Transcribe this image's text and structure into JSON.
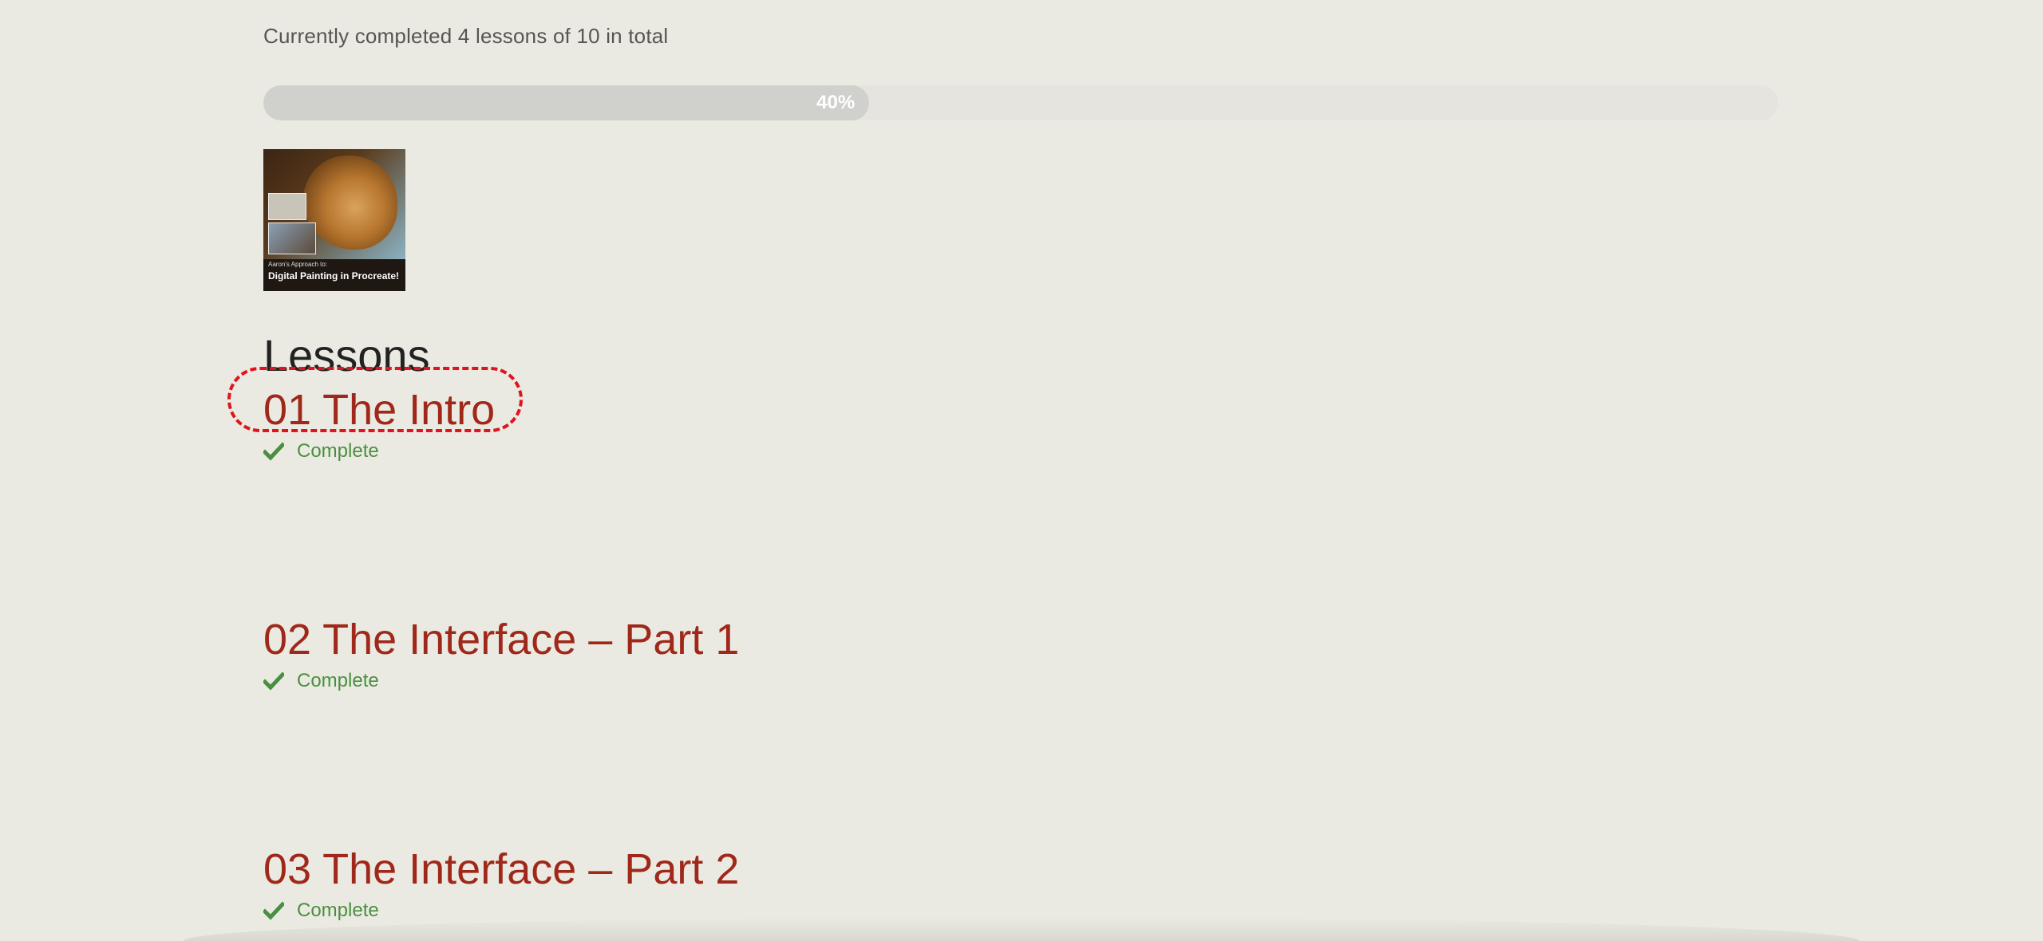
{
  "progress": {
    "summary_text": "Currently completed 4 lessons of 10 in total",
    "percent_label": "40%",
    "fraction": 0.4
  },
  "course_image": {
    "caption_small": "Aaron's Approach to:",
    "caption": "Digital Painting in Procreate!"
  },
  "lessons_heading": "Lessons",
  "lessons": [
    {
      "title": "01 The Intro",
      "status": "Complete",
      "status_icon": "checkmark-icon"
    },
    {
      "title": "02 The Interface – Part 1",
      "status": "Complete",
      "status_icon": "checkmark-icon"
    },
    {
      "title": "03 The Interface – Part 2",
      "status": "Complete",
      "status_icon": "checkmark-icon"
    }
  ],
  "colors": {
    "background": "#ebeae2",
    "lesson_link": "#a0281a",
    "complete_green": "#4a8f3f",
    "highlight_red": "#e0141d"
  }
}
